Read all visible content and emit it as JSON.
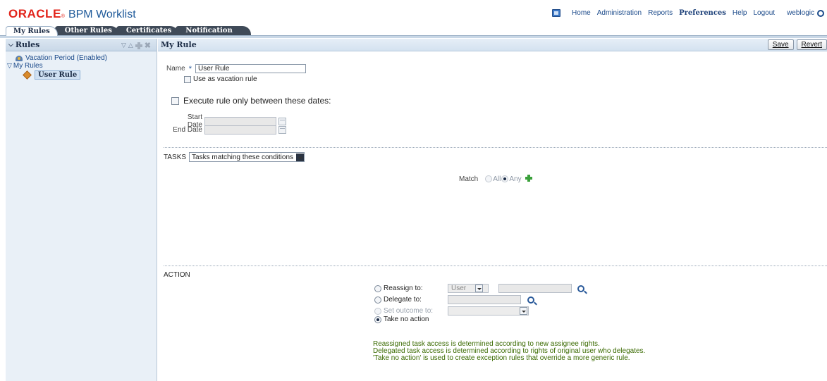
{
  "header": {
    "logo_brand": "ORACLE",
    "logo_registered": "®",
    "app_title": "BPM Worklist",
    "nav": [
      "Home",
      "Administration",
      "Reports"
    ],
    "nav_bold": "Preferences",
    "nav_after": [
      "Help",
      "Logout"
    ],
    "user": "weblogic"
  },
  "tabs": [
    "My Rules",
    "Other Rules",
    "Certificates",
    "Notification"
  ],
  "left": {
    "title": "Rules",
    "tree": {
      "vacation": "Vacation Period (Enabled)",
      "folder": "My Rules",
      "selected_rule": "User Rule"
    }
  },
  "main": {
    "title": "My Rule",
    "save_label": "Save",
    "revert_label": "Revert",
    "name_label": "Name",
    "name_required": "*",
    "name_value": "User Rule",
    "vacation_rule_label": "Use as vacation rule",
    "execute_dates_label": "Execute rule only between these dates:",
    "start_date_label": "Start Date",
    "end_date_label": "End Date",
    "tasks": {
      "label": "TASKS",
      "select_value": "Tasks matching these conditions",
      "match_label": "Match",
      "all_label": "All",
      "any_label": "Any"
    },
    "action": {
      "label": "ACTION",
      "reassign_label": "Reassign to:",
      "reassign_type": "User",
      "delegate_label": "Delegate to:",
      "set_outcome_label": "Set outcome to:",
      "no_action_label": "Take no action",
      "notes": [
        "Reassigned task access is determined according to new assignee rights.",
        "Delegated task access is determined according to rights of original user who delegates.",
        "'Take no action' is used to create exception rules that override a more generic rule."
      ]
    }
  },
  "colors": {
    "oracle_red": "#e2231a",
    "link_blue": "#1b4a8a",
    "tab_dark": "#3f4a58",
    "note_green": "#3a6a00"
  }
}
